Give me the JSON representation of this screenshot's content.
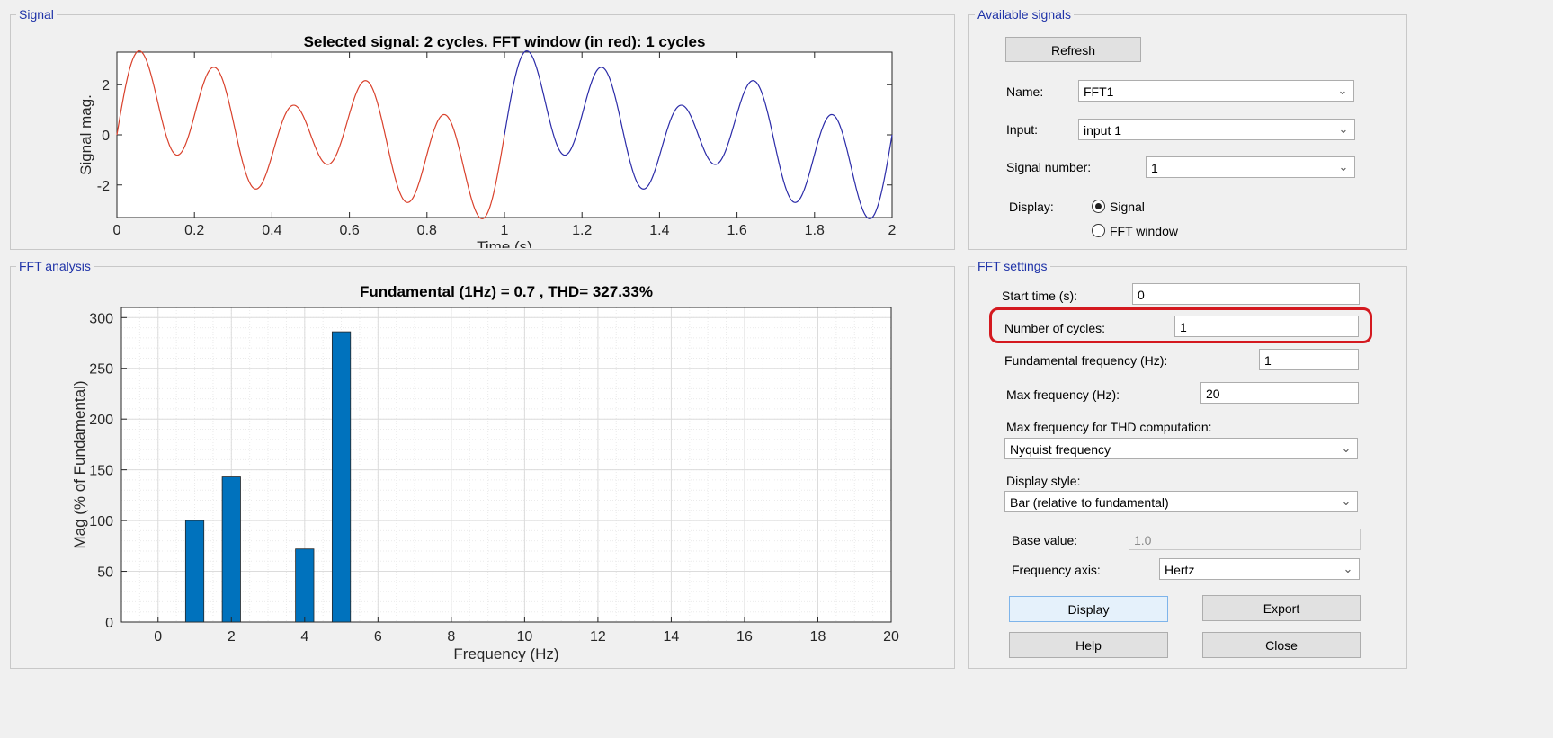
{
  "signal_panel": {
    "title": "Signal",
    "chart_title": "Selected signal: 2 cycles. FFT window (in red): 1 cycles",
    "ylabel": "Signal mag.",
    "xlabel": "Time (s)"
  },
  "fft_panel": {
    "title": "FFT analysis",
    "chart_title": "Fundamental (1Hz) = 0.7 , THD= 327.33%",
    "ylabel": "Mag (% of Fundamental)",
    "xlabel": "Frequency (Hz)"
  },
  "available_signals": {
    "title": "Available signals",
    "refresh_label": "Refresh",
    "name_label": "Name:",
    "name_value": "FFT1",
    "input_label": "Input:",
    "input_value": "input 1",
    "signal_number_label": "Signal number:",
    "signal_number_value": "1",
    "display_label": "Display:",
    "display_options": [
      "Signal",
      "FFT window"
    ],
    "display_selected": "Signal"
  },
  "fft_settings": {
    "title": "FFT settings",
    "start_time_label": "Start time (s):",
    "start_time_value": "0",
    "cycles_label": "Number of cycles:",
    "cycles_value": "1",
    "fund_freq_label": "Fundamental frequency (Hz):",
    "fund_freq_value": "1",
    "max_freq_label": "Max frequency (Hz):",
    "max_freq_value": "20",
    "thd_label": "Max frequency for THD computation:",
    "thd_value": "Nyquist frequency",
    "display_style_label": "Display style:",
    "display_style_value": "Bar (relative to fundamental)",
    "base_value_label": "Base value:",
    "base_value_value": "1.0",
    "freq_axis_label": "Frequency axis:",
    "freq_axis_value": "Hertz",
    "display_btn": "Display",
    "export_btn": "Export",
    "help_btn": "Help",
    "close_btn": "Close"
  },
  "colors": {
    "window_series": "#d9412c",
    "rest_series": "#2b2ba8",
    "bar": "#0072bd",
    "highlight": "#d4191f",
    "panel_title": "#1f33a8"
  },
  "chart_data": [
    {
      "type": "line",
      "title": "Selected signal: 2 cycles. FFT window (in red): 1 cycles",
      "xlabel": "Time (s)",
      "ylabel": "Signal mag.",
      "xlim": [
        0,
        2
      ],
      "ylim": [
        -3.3,
        3.3
      ],
      "xticks": [
        "0",
        "0.2",
        "0.4",
        "0.6",
        "0.8",
        "1",
        "1.2",
        "1.4",
        "1.6",
        "1.8",
        "2"
      ],
      "yticks": [
        "-2",
        "0",
        "2"
      ],
      "grid": false,
      "series": [
        {
          "color": "#d9412c",
          "x_range": [
            0,
            1
          ]
        },
        {
          "color": "#2b2ba8",
          "x_range": [
            1,
            2
          ]
        }
      ],
      "components": [
        {
          "freq_hz": 1,
          "amp": 0.7
        },
        {
          "freq_hz": 2,
          "amp": 1.0
        },
        {
          "freq_hz": 4,
          "amp": 0.5
        },
        {
          "freq_hz": 5,
          "amp": 2.0
        }
      ]
    },
    {
      "type": "bar",
      "title": "Fundamental (1Hz) = 0.7 , THD= 327.33%",
      "xlabel": "Frequency (Hz)",
      "ylabel": "Mag (% of Fundamental)",
      "xlim": [
        -1,
        20
      ],
      "ylim": [
        0,
        310
      ],
      "xticks": [
        "0",
        "2",
        "4",
        "6",
        "8",
        "10",
        "12",
        "14",
        "16",
        "18",
        "20"
      ],
      "yticks": [
        "0",
        "50",
        "100",
        "150",
        "200",
        "250",
        "300"
      ],
      "grid": true,
      "x": [
        1,
        2,
        4,
        5
      ],
      "values": [
        100,
        143,
        72,
        286
      ]
    }
  ]
}
